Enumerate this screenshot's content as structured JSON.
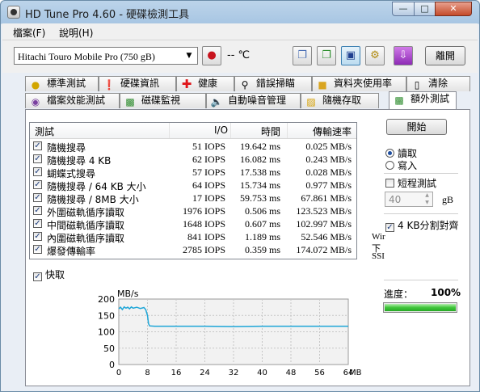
{
  "window": {
    "title": "HD Tune Pro 4.60 - 硬碟檢測工具"
  },
  "menu": [
    {
      "label": "檔案(F)"
    },
    {
      "label": "說明(H)"
    }
  ],
  "toolbar": {
    "drive": "Hitachi Touro Mobile Pro (750 gB)",
    "temperature": "-- ℃",
    "exit_label": "離開"
  },
  "tabs_top": [
    {
      "label": "標準測試",
      "icon": "gauge-icon"
    },
    {
      "label": "硬碟資訊",
      "icon": "info-icon"
    },
    {
      "label": "健康",
      "icon": "health-cross-icon"
    },
    {
      "label": "錯誤掃瞄",
      "icon": "magnifier-icon"
    },
    {
      "label": "資料夾使用率",
      "icon": "folder-icon"
    },
    {
      "label": "清除",
      "icon": "trash-icon"
    }
  ],
  "tabs_bottom": [
    {
      "label": "檔案效能測試",
      "icon": "file-benchmark-icon"
    },
    {
      "label": "磁碟監視",
      "icon": "disk-monitor-icon"
    },
    {
      "label": "自動噪音管理",
      "icon": "speaker-icon"
    },
    {
      "label": "隨機存取",
      "icon": "random-access-icon"
    },
    {
      "label": "額外測試",
      "icon": "extra-tests-icon",
      "active": true
    }
  ],
  "table": {
    "headers": {
      "test": "測試",
      "io": "I/O",
      "time": "時間",
      "rate": "傳輸速率"
    },
    "rows": [
      {
        "name": "隨機搜尋",
        "io": "51 IOPS",
        "time": "19.642 ms",
        "rate": "0.025 MB/s",
        "checked": true
      },
      {
        "name": "隨機搜尋 4 KB",
        "io": "62 IOPS",
        "time": "16.082 ms",
        "rate": "0.243 MB/s",
        "checked": true
      },
      {
        "name": "蝴蝶式搜尋",
        "io": "57 IOPS",
        "time": "17.538 ms",
        "rate": "0.028 MB/s",
        "checked": true
      },
      {
        "name": "隨機搜尋 / 64 KB 大小",
        "io": "64 IOPS",
        "time": "15.734 ms",
        "rate": "0.977 MB/s",
        "checked": true
      },
      {
        "name": "隨機搜尋 / 8MB 大小",
        "io": "17 IOPS",
        "time": "59.753 ms",
        "rate": "67.861 MB/s",
        "checked": true
      },
      {
        "name": "外圍磁軌循序讀取",
        "io": "1976 IOPS",
        "time": "0.506 ms",
        "rate": "123.523 MB/s",
        "checked": true
      },
      {
        "name": "中間磁軌循序讀取",
        "io": "1648 IOPS",
        "time": "0.607 ms",
        "rate": "102.997 MB/s",
        "checked": true
      },
      {
        "name": "內圍磁軌循序讀取",
        "io": "841 IOPS",
        "time": "1.189 ms",
        "rate": "52.546 MB/s",
        "checked": true
      },
      {
        "name": "爆發傳輸率",
        "io": "2785 IOPS",
        "time": "0.359 ms",
        "rate": "174.072 MB/s",
        "checked": true
      }
    ]
  },
  "quick": {
    "label": "快取",
    "checked": true
  },
  "controls": {
    "start_label": "開始",
    "read_label": "讀取",
    "write_label": "寫入",
    "mode": "read",
    "short_test_label": "短程測試",
    "short_test_checked": false,
    "short_test_value": "40",
    "short_test_unit": "gB",
    "align_label": "4 KB分割對齊",
    "align_checked": true,
    "cut_text": [
      "Wir",
      "下",
      "SSI"
    ],
    "progress_label": "進度：",
    "progress_value": "100%",
    "progress_fraction": 1.0
  },
  "chart_data": {
    "type": "line",
    "ylabel": "MB/s",
    "xlabel": "MB",
    "ylim": [
      0,
      200
    ],
    "xlim": [
      0,
      64
    ],
    "yticks": [
      0,
      50,
      100,
      150,
      200
    ],
    "xticks": [
      0,
      8,
      16,
      24,
      32,
      40,
      48,
      56,
      64
    ],
    "series": [
      {
        "color": "#1ea6d8",
        "points": [
          [
            0,
            170
          ],
          [
            0.5,
            175
          ],
          [
            1,
            168
          ],
          [
            1.5,
            176
          ],
          [
            2,
            172
          ],
          [
            2.5,
            175
          ],
          [
            3,
            170
          ],
          [
            3.5,
            176
          ],
          [
            4,
            172
          ],
          [
            5,
            175
          ],
          [
            6,
            171
          ],
          [
            7,
            174
          ],
          [
            7.5,
            168
          ],
          [
            8,
            150
          ],
          [
            8.3,
            125
          ],
          [
            8.6,
            118
          ],
          [
            10,
            117
          ],
          [
            16,
            117
          ],
          [
            24,
            117
          ],
          [
            32,
            116
          ],
          [
            40,
            117
          ],
          [
            48,
            117
          ],
          [
            56,
            117
          ],
          [
            64,
            117
          ]
        ]
      }
    ],
    "grid": true
  },
  "colors": {
    "accent": "#1ea6d8",
    "progress": "#2fb52c",
    "graph_bg": "#f2f2f2"
  }
}
